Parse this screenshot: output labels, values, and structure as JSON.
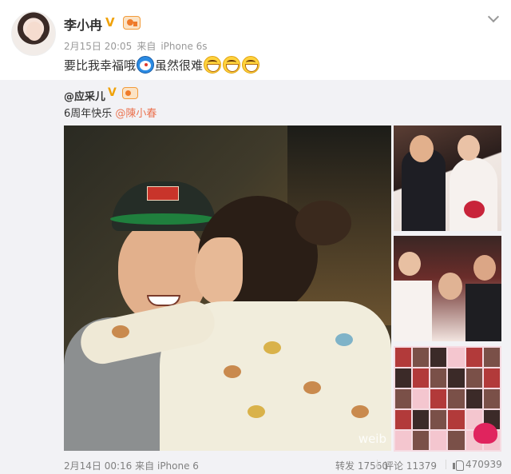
{
  "post": {
    "username": "李小冉",
    "verified_mark": "V",
    "date": "2月15日 20:05",
    "source_prefix": "来自",
    "source": "iPhone 6s",
    "text_part1": "要比我幸福哦",
    "text_part2": "虽然很难"
  },
  "repost": {
    "username": "@应采儿",
    "verified_mark": "V",
    "text": "6周年快乐 ",
    "mention": "@陳小春",
    "watermark": "weib"
  },
  "footer": {
    "date": "2月14日 00:16",
    "source_prefix": "来自",
    "source": "iPhone 6",
    "repost_label": "转发",
    "repost_count": "17560",
    "comment_label": "评论",
    "comment_count": "11379",
    "like_count": "470939"
  },
  "icons": {
    "more": "chevron-down-icon",
    "like": "thumbs-up-icon",
    "emoji_1": "doraemon-emoji-icon",
    "emoji_2": "laughing-emoji-icon"
  },
  "colors": {
    "mention": "#eb7350",
    "verified": "#f0a20a",
    "repost_bg": "#f2f2f5"
  }
}
